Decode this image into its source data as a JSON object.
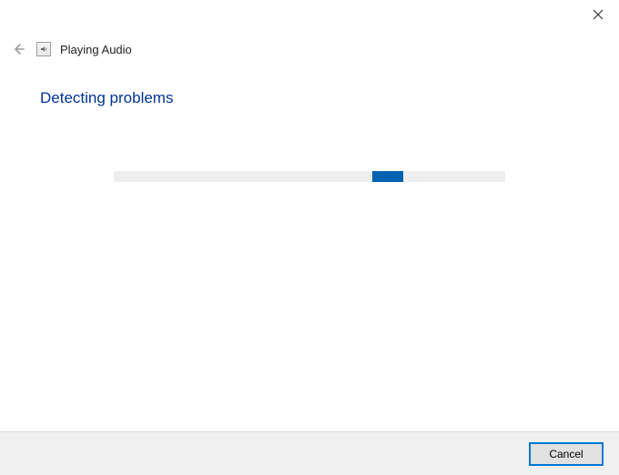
{
  "titlebar": {
    "close_label": "Close"
  },
  "header": {
    "back_label": "Back",
    "icon_label": "audio-troubleshooter-icon",
    "app_title": "Playing Audio"
  },
  "main": {
    "heading": "Detecting problems"
  },
  "progress": {
    "state": "indeterminate",
    "chunk_color": "#0063b1",
    "track_color": "#eeeeee"
  },
  "footer": {
    "cancel_label": "Cancel"
  }
}
